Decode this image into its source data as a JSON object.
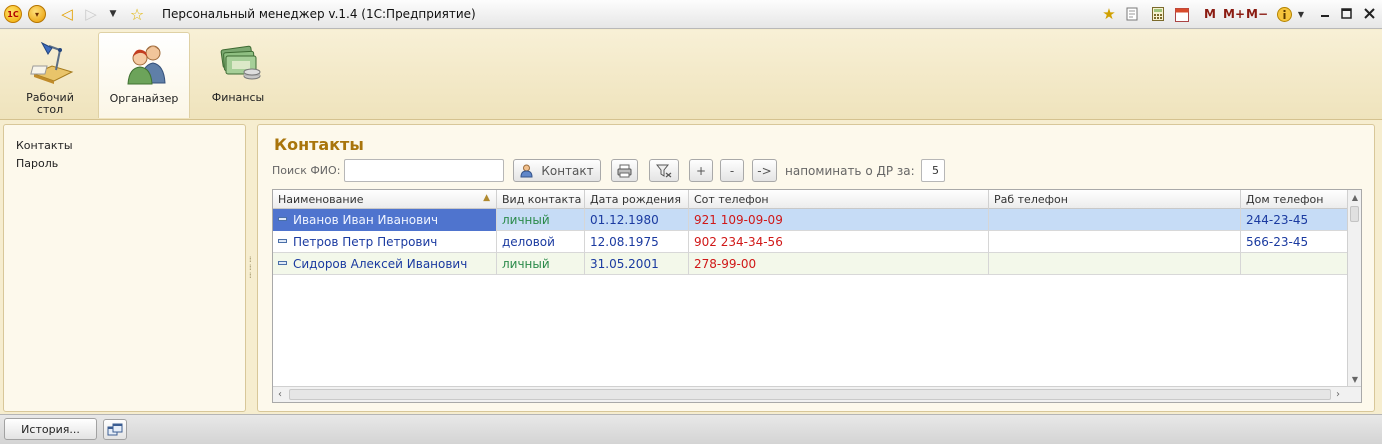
{
  "app": {
    "title": "Персональный менеджер v.1.4  (1С:Предприятие)",
    "logo_text": "1С"
  },
  "toolbar_right": {
    "calc_m": "M",
    "calc_mplus": "M+",
    "calc_mminus": "M−",
    "calendar_day": "31"
  },
  "sections": [
    {
      "label": "Рабочий\nстол",
      "icon": "desk-lamp-icon"
    },
    {
      "label": "Органайзер",
      "icon": "people-icon"
    },
    {
      "label": "Финансы",
      "icon": "money-icon"
    }
  ],
  "left_nav": {
    "items": [
      {
        "label": "Контакты"
      },
      {
        "label": "Пароль"
      }
    ]
  },
  "main": {
    "title": "Контакты",
    "search_label": "Поиск ФИО:",
    "search_value": "",
    "contact_button": "Контакт",
    "add_button": "+",
    "remove_button": "-",
    "next_button": "->",
    "remind_label": "напоминать о ДР за:",
    "remind_days": "5"
  },
  "table": {
    "columns": [
      "Наименование",
      "Вид контакта",
      "Дата рождения",
      "Сот телефон",
      "Раб телефон",
      "Дом телефон"
    ],
    "rows": [
      {
        "name": "Иванов Иван Иванович",
        "kind": "личный",
        "birth": "01.12.1980",
        "mobile": "921 109-09-09",
        "work": "",
        "home": "244-23-45"
      },
      {
        "name": "Петров Петр Петрович",
        "kind": "деловой",
        "birth": "12.08.1975",
        "mobile": "902 234-34-56",
        "work": "",
        "home": "566-23-45"
      },
      {
        "name": "Сидоров Алексей Иванович",
        "kind": "личный",
        "birth": "31.05.2001",
        "mobile": "278-99-00",
        "work": "",
        "home": ""
      }
    ]
  },
  "statusbar": {
    "history_button": "История..."
  }
}
